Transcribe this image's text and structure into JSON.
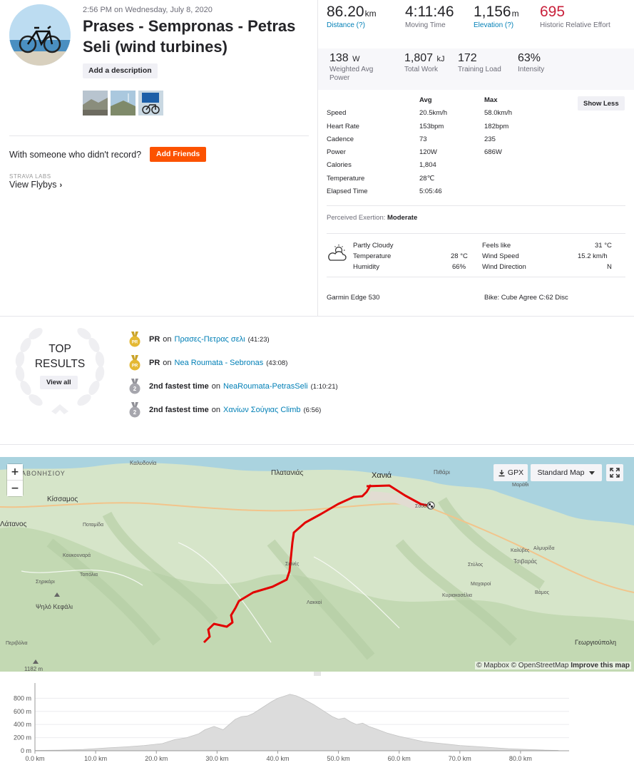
{
  "activity": {
    "datetime": "2:56 PM on Wednesday, July 8, 2020",
    "title": "Prases - Sempronas - Petras Seli (wind turbines)",
    "add_description": "Add a description",
    "photos": [
      "mountain-road-photo",
      "hilltop-photo",
      "bike-at-sign-photo"
    ],
    "with_someone_text": "With someone who didn't record?",
    "add_friends": "Add Friends",
    "labs_label": "STRAVA LABS",
    "view_flybys": "View Flybys"
  },
  "stats": {
    "primary": [
      {
        "value": "86.20",
        "unit": "km",
        "label": "Distance (?)",
        "link": true
      },
      {
        "value": "4:11:46",
        "unit": "",
        "label": "Moving Time",
        "link": false
      },
      {
        "value": "1,156",
        "unit": "m",
        "label": "Elevation (?)",
        "link": true
      },
      {
        "value": "695",
        "unit": "",
        "label": "Historic Relative Effort",
        "link": false
      }
    ],
    "secondary": [
      {
        "value": "138",
        "unit": "W",
        "label": "Weighted Avg Power"
      },
      {
        "value": "1,807",
        "unit": "kJ",
        "label": "Total Work"
      },
      {
        "value": "172",
        "unit": "",
        "label": "Training Load"
      },
      {
        "value": "63%",
        "unit": "",
        "label": "Intensity"
      }
    ]
  },
  "details": {
    "show_less": "Show Less",
    "header": {
      "avg": "Avg",
      "max": "Max"
    },
    "rows": [
      {
        "label": "Speed",
        "avg": "20.5km/h",
        "max": "58.0km/h"
      },
      {
        "label": "Heart Rate",
        "avg": "153bpm",
        "max": "182bpm"
      },
      {
        "label": "Cadence",
        "avg": "73",
        "max": "235"
      },
      {
        "label": "Power",
        "avg": "120W",
        "max": "686W"
      },
      {
        "label": "Calories",
        "avg": "1,804",
        "max": ""
      },
      {
        "label": "Temperature",
        "avg": "28℃",
        "max": ""
      },
      {
        "label": "Elapsed Time",
        "avg": "5:05:46",
        "max": ""
      }
    ],
    "exertion_label": "Perceived Exertion:",
    "exertion_value": "Moderate",
    "weather": {
      "condition": "Partly Cloudy",
      "temperature_label": "Temperature",
      "temperature": "28 °C",
      "humidity_label": "Humidity",
      "humidity": "66%",
      "feels_like_label": "Feels like",
      "feels_like": "31 °C",
      "wind_speed_label": "Wind Speed",
      "wind_speed": "15.2 km/h",
      "wind_direction_label": "Wind Direction",
      "wind_direction": "N"
    },
    "device": "Garmin Edge 530",
    "bike": "Bike: Cube Agree C:62 Disc"
  },
  "top_results": {
    "title_line1": "TOP",
    "title_line2": "RESULTS",
    "view_all": "View all",
    "items": [
      {
        "medal": "pr-gold",
        "badge": "PR",
        "achievement": "PR",
        "on": "on",
        "segment": "Πρασες-Πετρας σελι",
        "time": "(41:23)"
      },
      {
        "medal": "pr-gold",
        "badge": "PR",
        "achievement": "PR",
        "on": "on",
        "segment": "Nea Roumata - Sebronas",
        "time": "(43:08)"
      },
      {
        "medal": "silver-2",
        "badge": "2",
        "achievement": "2nd fastest time",
        "on": "on",
        "segment": "NeaRoumata-PetrasSeli",
        "time": "(1:10:21)"
      },
      {
        "medal": "silver-2",
        "badge": "2",
        "achievement": "2nd fastest time",
        "on": "on",
        "segment": "Χανίων Σούγιας Climb",
        "time": "(6:56)"
      }
    ]
  },
  "map": {
    "zoom_in": "+",
    "zoom_out": "−",
    "gpx": "GPX",
    "map_style": "Standard Map",
    "attribution_a": "© Mapbox © OpenStreetMap",
    "attribution_b": "Improve this map",
    "places": [
      "ΑΒΟΝΗΣΙΟΥ",
      "Καλυδονία",
      "Πλατανιάς",
      "Χανιά",
      "Πιθάρι",
      "Κίσσαμος",
      "Λάτανος",
      "Ποταμίδα",
      "Κουκουναρά",
      "Τοπόλια",
      "Σηρικάρι",
      "Ψηλό Κεφάλι",
      "Περιβόλια",
      "1182 m",
      "Σκινές",
      "Λακκοί",
      "Καλύβες",
      "Αλμυρίδα",
      "Τσιβαράς",
      "Στύλος",
      "Μαχαιροί",
      "Κυριακοσέλια",
      "Βάμος",
      "Γεωργιούπολη",
      "Μαράθι",
      "Σούδα"
    ],
    "colors": {
      "route": "#e20000",
      "water": "#aad3df",
      "land": "#cfe0c3"
    }
  },
  "chart_data": {
    "type": "area",
    "xlabel": "",
    "ylabel": "",
    "x_unit": "km",
    "x_ticks": [
      "0.0 km",
      "10.0 km",
      "20.0 km",
      "30.0 km",
      "40.0 km",
      "50.0 km",
      "60.0 km",
      "70.0 km",
      "80.0 km"
    ],
    "y_ticks": [
      "0 m",
      "200 m",
      "400 m",
      "600 m",
      "800 m"
    ],
    "xlim": [
      0,
      88
    ],
    "ylim": [
      0,
      880
    ],
    "x": [
      0,
      4,
      8,
      12,
      15,
      18,
      21,
      23,
      25,
      27,
      28,
      29.5,
      31,
      32,
      33,
      34,
      35,
      36,
      37,
      38,
      39,
      40,
      41,
      42,
      43,
      44,
      45,
      46,
      47,
      48,
      49,
      50,
      51,
      52,
      53,
      54,
      55,
      56,
      58,
      60,
      62,
      64,
      66,
      68,
      70,
      72,
      75,
      78,
      81,
      84,
      86.2
    ],
    "y": [
      5,
      10,
      20,
      45,
      60,
      80,
      110,
      170,
      200,
      260,
      320,
      370,
      320,
      400,
      480,
      520,
      530,
      570,
      630,
      690,
      750,
      800,
      830,
      860,
      840,
      800,
      750,
      700,
      640,
      580,
      520,
      480,
      500,
      440,
      400,
      420,
      370,
      340,
      270,
      220,
      180,
      140,
      120,
      100,
      80,
      70,
      50,
      30,
      20,
      10,
      5
    ],
    "fill": "#dcdcdc",
    "grid": true
  }
}
